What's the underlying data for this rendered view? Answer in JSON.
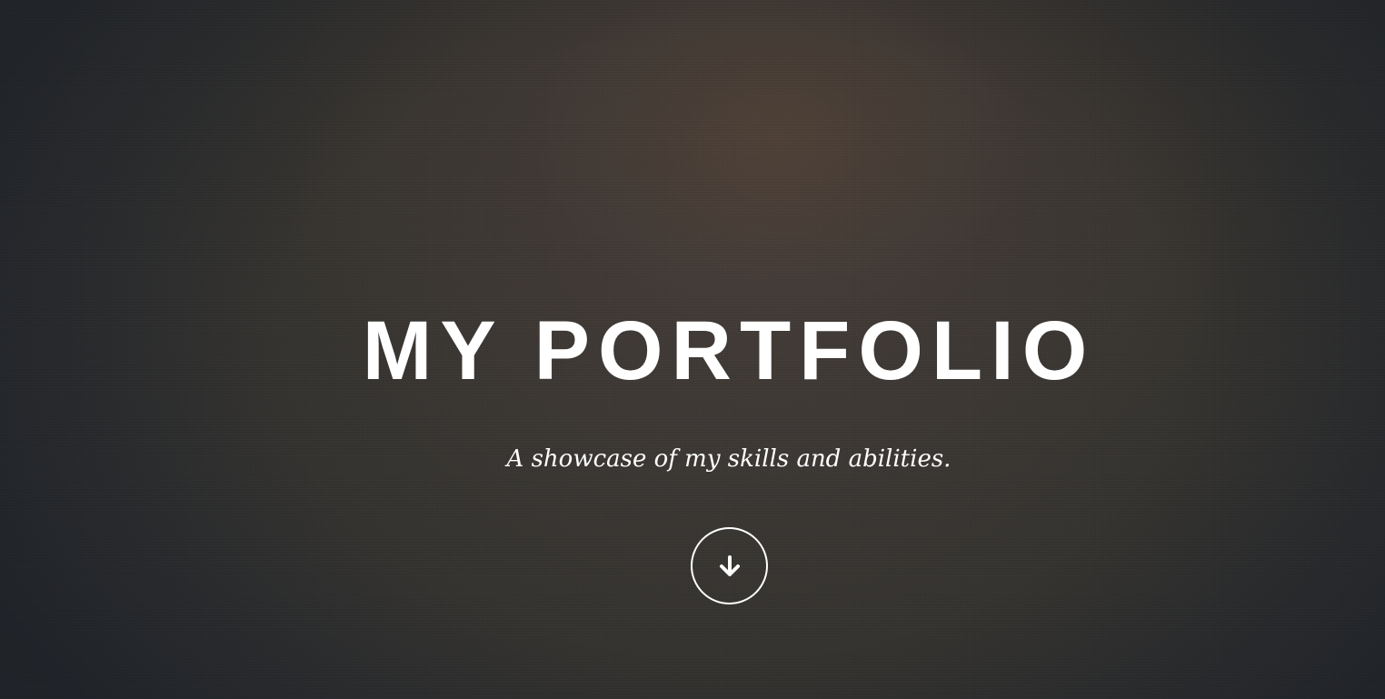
{
  "hero": {
    "title": "MY PORTFOLIO",
    "subtitle": "A showcase of my skills and abilities.",
    "scroll_button": {
      "icon": "arrow-down-icon",
      "color": "#ffffff"
    }
  },
  "colors": {
    "text": "#ffffff",
    "background_dark": "#2a2c30",
    "background_warm": "#4a3c34"
  }
}
